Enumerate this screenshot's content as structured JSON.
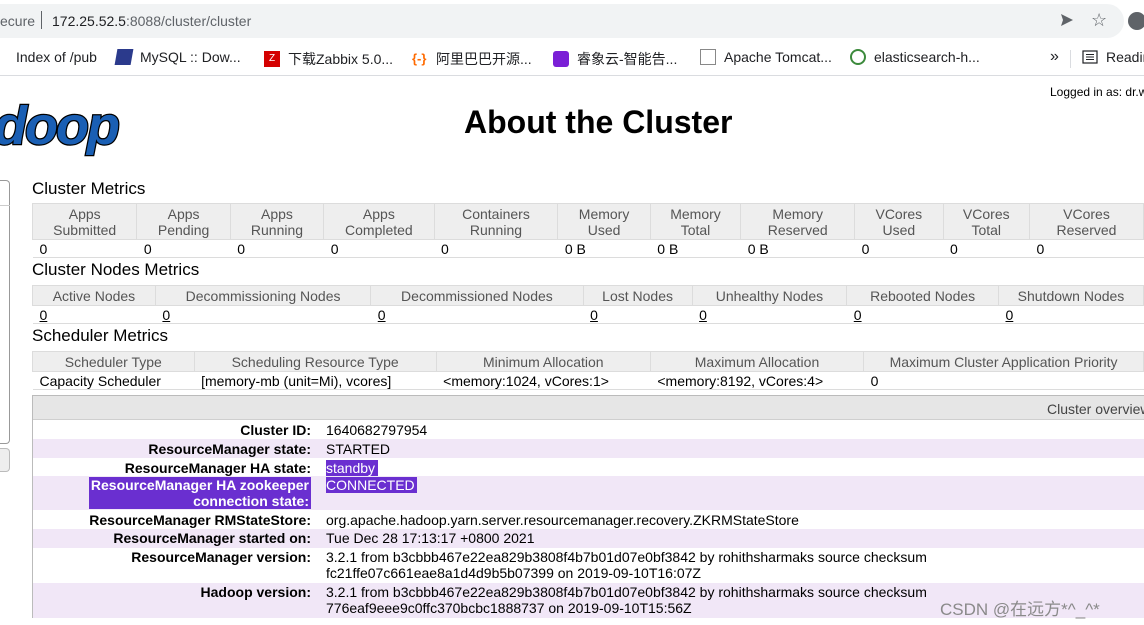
{
  "browser": {
    "secure_label": "ecure",
    "url_host": "172.25.52.5",
    "url_rest": ":8088/cluster/cluster",
    "bookmarks": [
      {
        "label": "Index of /pub",
        "icon": "folder-icon"
      },
      {
        "label": "MySQL :: Dow...",
        "icon": "mysql-icon"
      },
      {
        "label": "下载Zabbix 5.0...",
        "icon": "zabbix-icon"
      },
      {
        "label": "阿里巴巴开源...",
        "icon": "alibaba-icon"
      },
      {
        "label": "睿象云-智能告...",
        "icon": "ruixiang-icon"
      },
      {
        "label": "Apache Tomcat...",
        "icon": "tomcat-icon"
      },
      {
        "label": "elasticsearch-h...",
        "icon": "elasticsearch-icon"
      },
      {
        "label": "Readin",
        "icon": "reading-list-icon"
      }
    ],
    "more_label": "»"
  },
  "header": {
    "logged_in": "Logged in as: dr.w",
    "logo_text": "doop",
    "title": "About the Cluster"
  },
  "cluster_metrics": {
    "title": "Cluster Metrics",
    "headers": [
      [
        "Apps",
        "Submitted"
      ],
      [
        "Apps",
        "Pending"
      ],
      [
        "Apps",
        "Running"
      ],
      [
        "Apps",
        "Completed"
      ],
      [
        "Containers",
        "Running"
      ],
      [
        "Memory",
        "Used"
      ],
      [
        "Memory",
        "Total"
      ],
      [
        "Memory",
        "Reserved"
      ],
      [
        "VCores",
        "Used"
      ],
      [
        "VCores",
        "Total"
      ],
      [
        "VCores",
        "Reserved"
      ]
    ],
    "values": [
      "0",
      "0",
      "0",
      "0",
      "0",
      "0 B",
      "0 B",
      "0 B",
      "0",
      "0",
      "0"
    ]
  },
  "nodes_metrics": {
    "title": "Cluster Nodes Metrics",
    "headers": [
      "Active Nodes",
      "Decommissioning Nodes",
      "Decommissioned Nodes",
      "Lost Nodes",
      "Unhealthy Nodes",
      "Rebooted Nodes",
      "Shutdown Nodes"
    ],
    "values": [
      "0",
      "0",
      "0",
      "0",
      "0",
      "0",
      "0"
    ]
  },
  "scheduler_metrics": {
    "title": "Scheduler Metrics",
    "headers": [
      "Scheduler Type",
      "Scheduling Resource Type",
      "Minimum Allocation",
      "Maximum Allocation",
      "Maximum Cluster Application Priority"
    ],
    "values": [
      "Capacity Scheduler",
      "[memory-mb (unit=Mi), vcores]",
      "<memory:1024, vCores:1>",
      "<memory:8192, vCores:4>",
      "0"
    ]
  },
  "overview": {
    "header": "Cluster overview",
    "rows": [
      {
        "key": "Cluster ID:",
        "value": "1640682797954"
      },
      {
        "key": "ResourceManager state:",
        "value": "STARTED"
      },
      {
        "key": "ResourceManager HA state:",
        "value": "standby"
      },
      {
        "key": "ResourceManager HA zookeeper connection state:",
        "key_line1": "ResourceManager HA zookeeper",
        "key_line2": "connection state:",
        "value": "CONNECTED"
      },
      {
        "key": "ResourceManager RMStateStore:",
        "value": "org.apache.hadoop.yarn.server.resourcemanager.recovery.ZKRMStateStore"
      },
      {
        "key": "ResourceManager started on:",
        "value": "Tue Dec 28 17:13:17 +0800 2021"
      },
      {
        "key": "ResourceManager version:",
        "value_line1": "3.2.1 from b3cbbb467e22ea829b3808f4b7b01d07e0bf3842 by rohithsharmaks source checksum",
        "value_line2": "fc21ffe07c661eae8a1d4d9b5b07399 on 2019-09-10T16:07Z"
      },
      {
        "key": "Hadoop version:",
        "value_line1": "3.2.1 from b3cbbb467e22ea829b3808f4b7b01d07e0bf3842 by rohithsharmaks source checksum",
        "value_line2": "776eaf9eee9c0ffc370bcbc1888737 on 2019-09-10T15:56Z"
      }
    ]
  },
  "watermark": "CSDN @在远方*^_^*",
  "colors": {
    "highlight": "#6a2fd0",
    "alt_row": "#f1e7f7",
    "logo_blue": "#1a5fb4"
  }
}
